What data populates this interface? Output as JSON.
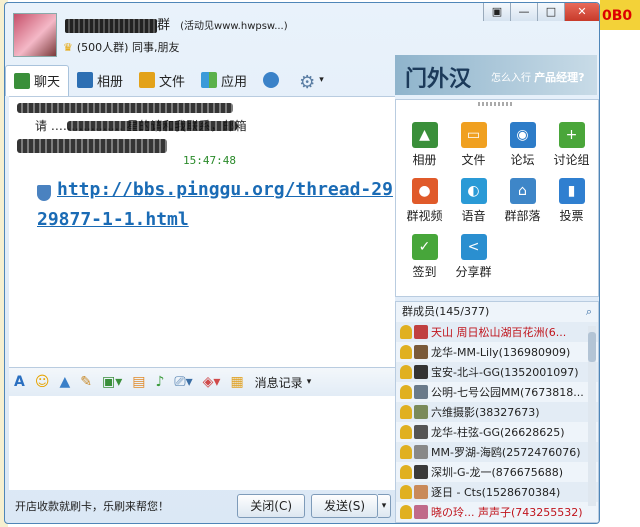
{
  "header": {
    "group_name_suffix": "群",
    "group_activity": "(活动见www.hwpsw...)",
    "group_size": "(500人群) 同事,朋友",
    "window_buttons": [
      "▣",
      "—",
      "□",
      "✕"
    ]
  },
  "tabs": [
    {
      "label": "聊天",
      "icon": "chat-icon"
    },
    {
      "label": "相册",
      "icon": "album-icon"
    },
    {
      "label": "文件",
      "icon": "file-icon"
    },
    {
      "label": "应用",
      "icon": "app-icon"
    }
  ],
  "ad": {
    "title": "门外汉",
    "subtitle": "怎么入行",
    "tag": "产品经理?"
  },
  "chat": {
    "message_text": "请 ……………… 星的请和我联系，邮箱",
    "time": "15:47:48",
    "link": "http://bbs.pinggu.org/thread-2929877-1-1.html"
  },
  "format_bar": {
    "history_label": "消息记录"
  },
  "bottom": {
    "promo": "开店收款就刷卡，乐刷来帮您！",
    "close_label": "关闭(C)",
    "send_label": "发送(S)"
  },
  "apps": [
    {
      "label": "相册",
      "color": "#3a8f3a",
      "glyph": "▲"
    },
    {
      "label": "文件",
      "color": "#f0a020",
      "glyph": "▭"
    },
    {
      "label": "论坛",
      "color": "#2d7cc8",
      "glyph": "◉"
    },
    {
      "label": "讨论组",
      "color": "#4aa63a",
      "glyph": "+"
    },
    {
      "label": "群视频",
      "color": "#e05a2a",
      "glyph": "●"
    },
    {
      "label": "语音",
      "color": "#2a9ad6",
      "glyph": "◐"
    },
    {
      "label": "群部落",
      "color": "#3e86c8",
      "glyph": "⌂"
    },
    {
      "label": "投票",
      "color": "#2f7fd0",
      "glyph": "▮"
    },
    {
      "label": "签到",
      "color": "#47a63a",
      "glyph": "✓"
    },
    {
      "label": "分享群",
      "color": "#2a8fd0",
      "glyph": "<"
    }
  ],
  "members": {
    "header": "群成员(145/377)",
    "list": [
      {
        "name": "天山 周日松山湖百花洲(6...",
        "red": true,
        "color": "#c04040"
      },
      {
        "name": "龙华-MM-Lily(136980909)",
        "red": false,
        "color": "#7a5a3a"
      },
      {
        "name": "宝安-北斗-GG(1352001097)",
        "red": false,
        "color": "#333"
      },
      {
        "name": "公明-七号公园MM(7673818...",
        "red": false,
        "color": "#6a7a8a"
      },
      {
        "name": "六维摄影(38327673)",
        "red": false,
        "color": "#7a8a5a"
      },
      {
        "name": "龙华-柱弦-GG(26628625)",
        "red": false,
        "color": "#555"
      },
      {
        "name": "MM-罗湖-海鸥(2572476076)",
        "red": false,
        "color": "#888"
      },
      {
        "name": "深圳-G-龙一(876675688)",
        "red": false,
        "color": "#3a3a3a"
      },
      {
        "name": "逐日 - Cts(1528670384)",
        "red": false,
        "color": "#c98a5a"
      },
      {
        "name": "晓の玲... 声声子(743255532)",
        "red": true,
        "color": "#c06a8a"
      }
    ]
  }
}
